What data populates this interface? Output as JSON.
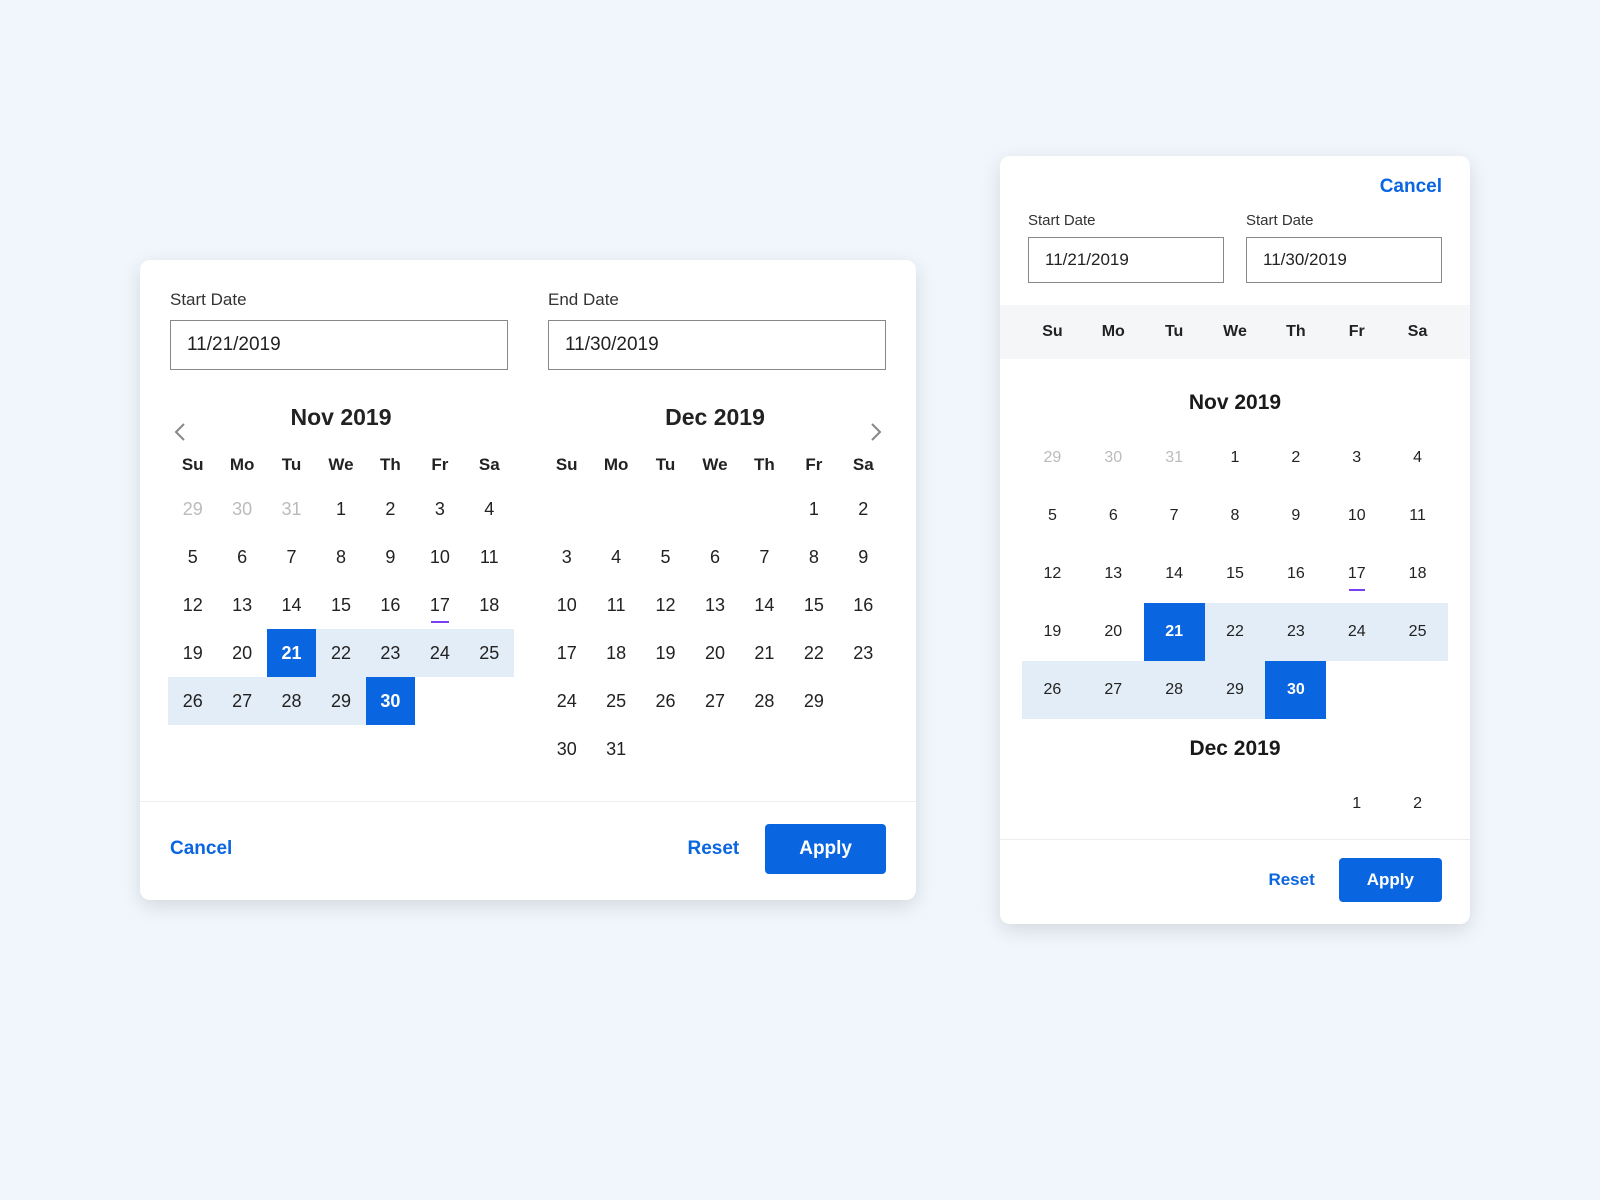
{
  "colors": {
    "primary": "#0a66e0",
    "range": "#e3edf7",
    "today_underline": "#7b3ff2"
  },
  "desktop": {
    "start_field": {
      "label": "Start Date",
      "value": "11/21/2019"
    },
    "end_field": {
      "label": "End Date",
      "value": "11/30/2019"
    },
    "dow": [
      "Su",
      "Mo",
      "Tu",
      "We",
      "Th",
      "Fr",
      "Sa"
    ],
    "months": [
      {
        "title": "Nov 2019",
        "rows": [
          [
            {
              "n": "29",
              "muted": true
            },
            {
              "n": "30",
              "muted": true
            },
            {
              "n": "31",
              "muted": true
            },
            {
              "n": "1"
            },
            {
              "n": "2"
            },
            {
              "n": "3"
            },
            {
              "n": "4"
            }
          ],
          [
            {
              "n": "5"
            },
            {
              "n": "6"
            },
            {
              "n": "7"
            },
            {
              "n": "8"
            },
            {
              "n": "9"
            },
            {
              "n": "10"
            },
            {
              "n": "11"
            }
          ],
          [
            {
              "n": "12"
            },
            {
              "n": "13"
            },
            {
              "n": "14"
            },
            {
              "n": "15"
            },
            {
              "n": "16"
            },
            {
              "n": "17",
              "today": true
            },
            {
              "n": "18"
            }
          ],
          [
            {
              "n": "19"
            },
            {
              "n": "20"
            },
            {
              "n": "21",
              "selected": true
            },
            {
              "n": "22",
              "range": true
            },
            {
              "n": "23",
              "range": true
            },
            {
              "n": "24",
              "range": true
            },
            {
              "n": "25",
              "range": true
            }
          ],
          [
            {
              "n": "26",
              "range": true
            },
            {
              "n": "27",
              "range": true
            },
            {
              "n": "28",
              "range": true
            },
            {
              "n": "29",
              "range": true
            },
            {
              "n": "30",
              "selected": true
            },
            {
              "n": ""
            },
            {
              "n": ""
            }
          ]
        ]
      },
      {
        "title": "Dec 2019",
        "rows": [
          [
            {
              "n": ""
            },
            {
              "n": ""
            },
            {
              "n": ""
            },
            {
              "n": ""
            },
            {
              "n": ""
            },
            {
              "n": "1"
            },
            {
              "n": "2"
            }
          ],
          [
            {
              "n": "3"
            },
            {
              "n": "4"
            },
            {
              "n": "5"
            },
            {
              "n": "6"
            },
            {
              "n": "7"
            },
            {
              "n": "8"
            },
            {
              "n": "9"
            }
          ],
          [
            {
              "n": "10"
            },
            {
              "n": "11"
            },
            {
              "n": "12"
            },
            {
              "n": "13"
            },
            {
              "n": "14"
            },
            {
              "n": "15"
            },
            {
              "n": "16"
            }
          ],
          [
            {
              "n": "17"
            },
            {
              "n": "18"
            },
            {
              "n": "19"
            },
            {
              "n": "20"
            },
            {
              "n": "21"
            },
            {
              "n": "22"
            },
            {
              "n": "23"
            }
          ],
          [
            {
              "n": "24"
            },
            {
              "n": "25"
            },
            {
              "n": "26"
            },
            {
              "n": "27"
            },
            {
              "n": "28"
            },
            {
              "n": "29"
            },
            {
              "n": ""
            }
          ],
          [
            {
              "n": "30"
            },
            {
              "n": "31"
            },
            {
              "n": ""
            },
            {
              "n": ""
            },
            {
              "n": ""
            },
            {
              "n": ""
            },
            {
              "n": ""
            }
          ]
        ]
      }
    ],
    "footer": {
      "cancel": "Cancel",
      "reset": "Reset",
      "apply": "Apply"
    }
  },
  "mobile": {
    "header": {
      "cancel": "Cancel"
    },
    "start_field": {
      "label": "Start Date",
      "value": "11/21/2019"
    },
    "end_field": {
      "label": "Start Date",
      "value": "11/30/2019"
    },
    "dow": [
      "Su",
      "Mo",
      "Tu",
      "We",
      "Th",
      "Fr",
      "Sa"
    ],
    "months": [
      {
        "title": "Nov 2019",
        "rows": [
          [
            {
              "n": "29",
              "muted": true
            },
            {
              "n": "30",
              "muted": true
            },
            {
              "n": "31",
              "muted": true
            },
            {
              "n": "1"
            },
            {
              "n": "2"
            },
            {
              "n": "3"
            },
            {
              "n": "4"
            }
          ],
          [
            {
              "n": "5"
            },
            {
              "n": "6"
            },
            {
              "n": "7"
            },
            {
              "n": "8"
            },
            {
              "n": "9"
            },
            {
              "n": "10"
            },
            {
              "n": "11"
            }
          ],
          [
            {
              "n": "12"
            },
            {
              "n": "13"
            },
            {
              "n": "14"
            },
            {
              "n": "15"
            },
            {
              "n": "16"
            },
            {
              "n": "17",
              "today": true
            },
            {
              "n": "18"
            }
          ],
          [
            {
              "n": "19"
            },
            {
              "n": "20"
            },
            {
              "n": "21",
              "selected": true
            },
            {
              "n": "22",
              "range": true
            },
            {
              "n": "23",
              "range": true
            },
            {
              "n": "24",
              "range": true
            },
            {
              "n": "25",
              "range": true
            }
          ],
          [
            {
              "n": "26",
              "range": true
            },
            {
              "n": "27",
              "range": true
            },
            {
              "n": "28",
              "range": true
            },
            {
              "n": "29",
              "range": true
            },
            {
              "n": "30",
              "selected": true
            },
            {
              "n": ""
            },
            {
              "n": ""
            }
          ]
        ]
      },
      {
        "title": "Dec 2019",
        "rows": [
          [
            {
              "n": ""
            },
            {
              "n": ""
            },
            {
              "n": ""
            },
            {
              "n": ""
            },
            {
              "n": ""
            },
            {
              "n": "1"
            },
            {
              "n": "2"
            }
          ]
        ]
      }
    ],
    "footer": {
      "reset": "Reset",
      "apply": "Apply"
    }
  }
}
